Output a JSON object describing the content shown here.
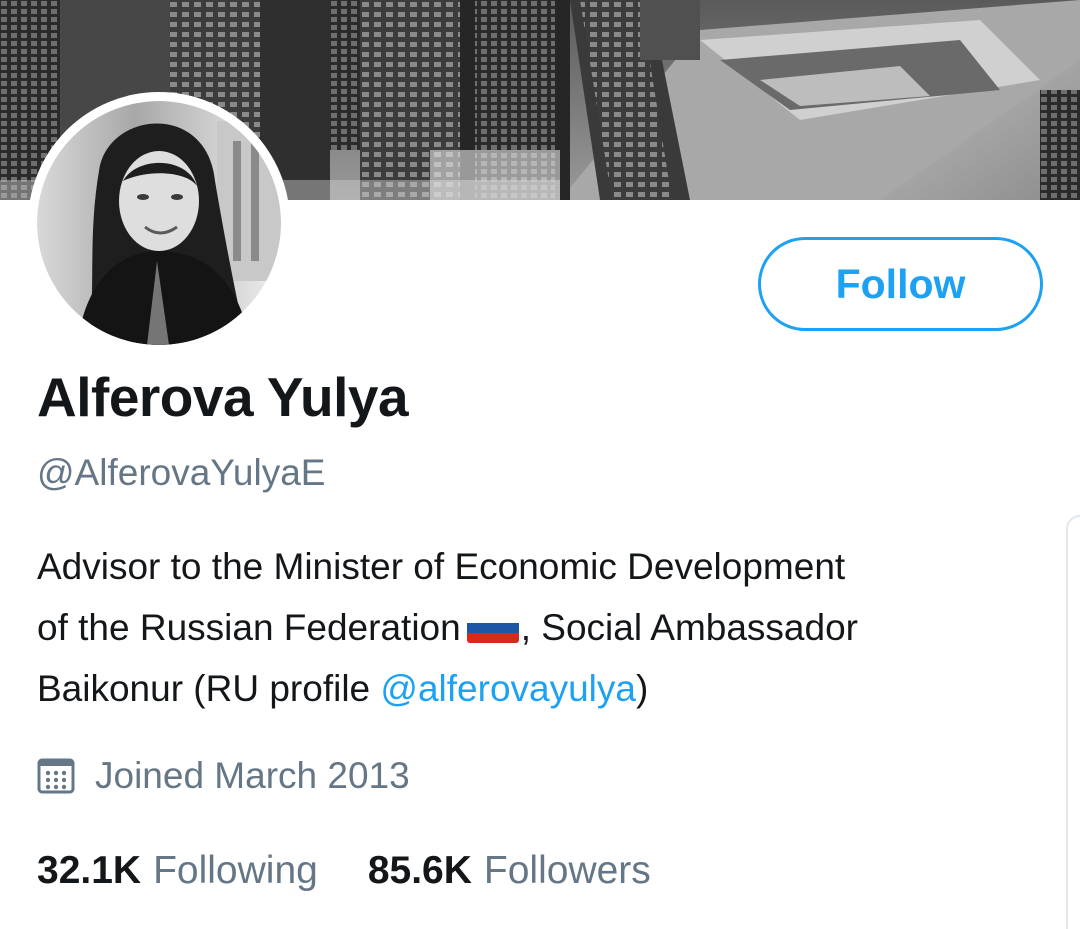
{
  "profile": {
    "display_name": "Alferova Yulya",
    "handle": "@AlferovaYulyaE",
    "bio": {
      "line1": "Advisor to the Minister of Economic Development",
      "line2_before_flag": "of the Russian Federation",
      "line2_after_flag": ", Social Ambassador",
      "line3_before_mention": "Baikonur (RU profile ",
      "mention": "@alferovayulya",
      "line3_after_mention": ")"
    },
    "flag_icon": "russia-flag-icon",
    "joined": "Joined March 2013",
    "calendar_icon": "calendar-icon"
  },
  "actions": {
    "follow_label": "Follow"
  },
  "stats": {
    "following_count": "32.1K",
    "following_label": "Following",
    "followers_count": "85.6K",
    "followers_label": "Followers"
  },
  "colors": {
    "accent": "#1da1f2",
    "text_primary": "#14171a",
    "text_secondary": "#657786"
  }
}
